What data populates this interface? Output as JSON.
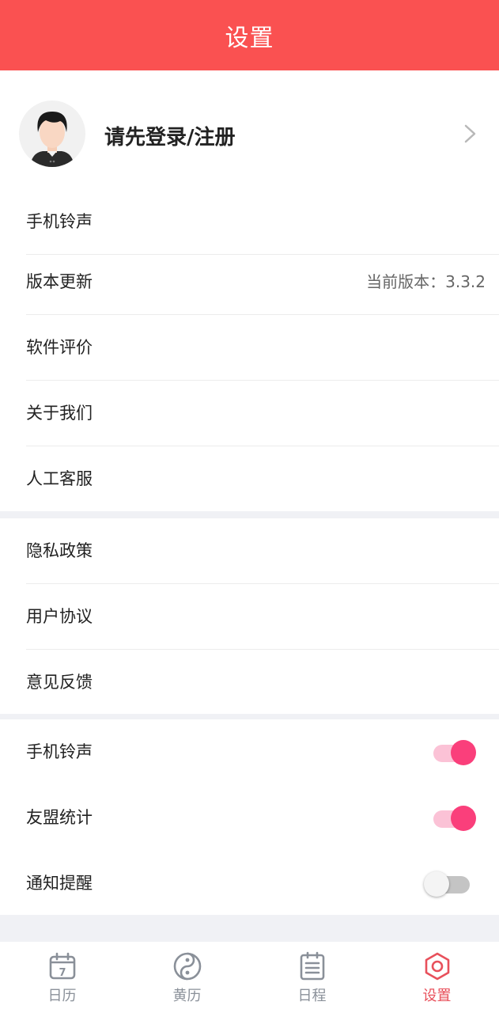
{
  "header": {
    "title": "设置"
  },
  "profile": {
    "login_text": "请先登录/注册"
  },
  "menu_group_1": [
    {
      "label": "手机铃声"
    },
    {
      "label": "版本更新",
      "value": "当前版本：3.3.2"
    },
    {
      "label": "软件评价"
    },
    {
      "label": "关于我们"
    },
    {
      "label": "人工客服"
    }
  ],
  "menu_group_2": [
    {
      "label": "隐私政策"
    },
    {
      "label": "用户协议"
    },
    {
      "label": "意见反馈"
    }
  ],
  "toggles": [
    {
      "label": "手机铃声",
      "on": true
    },
    {
      "label": "友盟统计",
      "on": true
    },
    {
      "label": "通知提醒",
      "on": false
    }
  ],
  "tabbar": [
    {
      "label": "日历",
      "icon": "calendar-icon",
      "active": false,
      "icon_text": "7"
    },
    {
      "label": "黄历",
      "icon": "yin-yang-icon",
      "active": false
    },
    {
      "label": "日程",
      "icon": "schedule-list-icon",
      "active": false
    },
    {
      "label": "设置",
      "icon": "settings-hex-icon",
      "active": true
    }
  ],
  "colors": {
    "header": "#fa5151",
    "toggle_on": "#fa3f7b",
    "tab_active": "#e8505b",
    "tab_inactive": "#8a9099"
  }
}
